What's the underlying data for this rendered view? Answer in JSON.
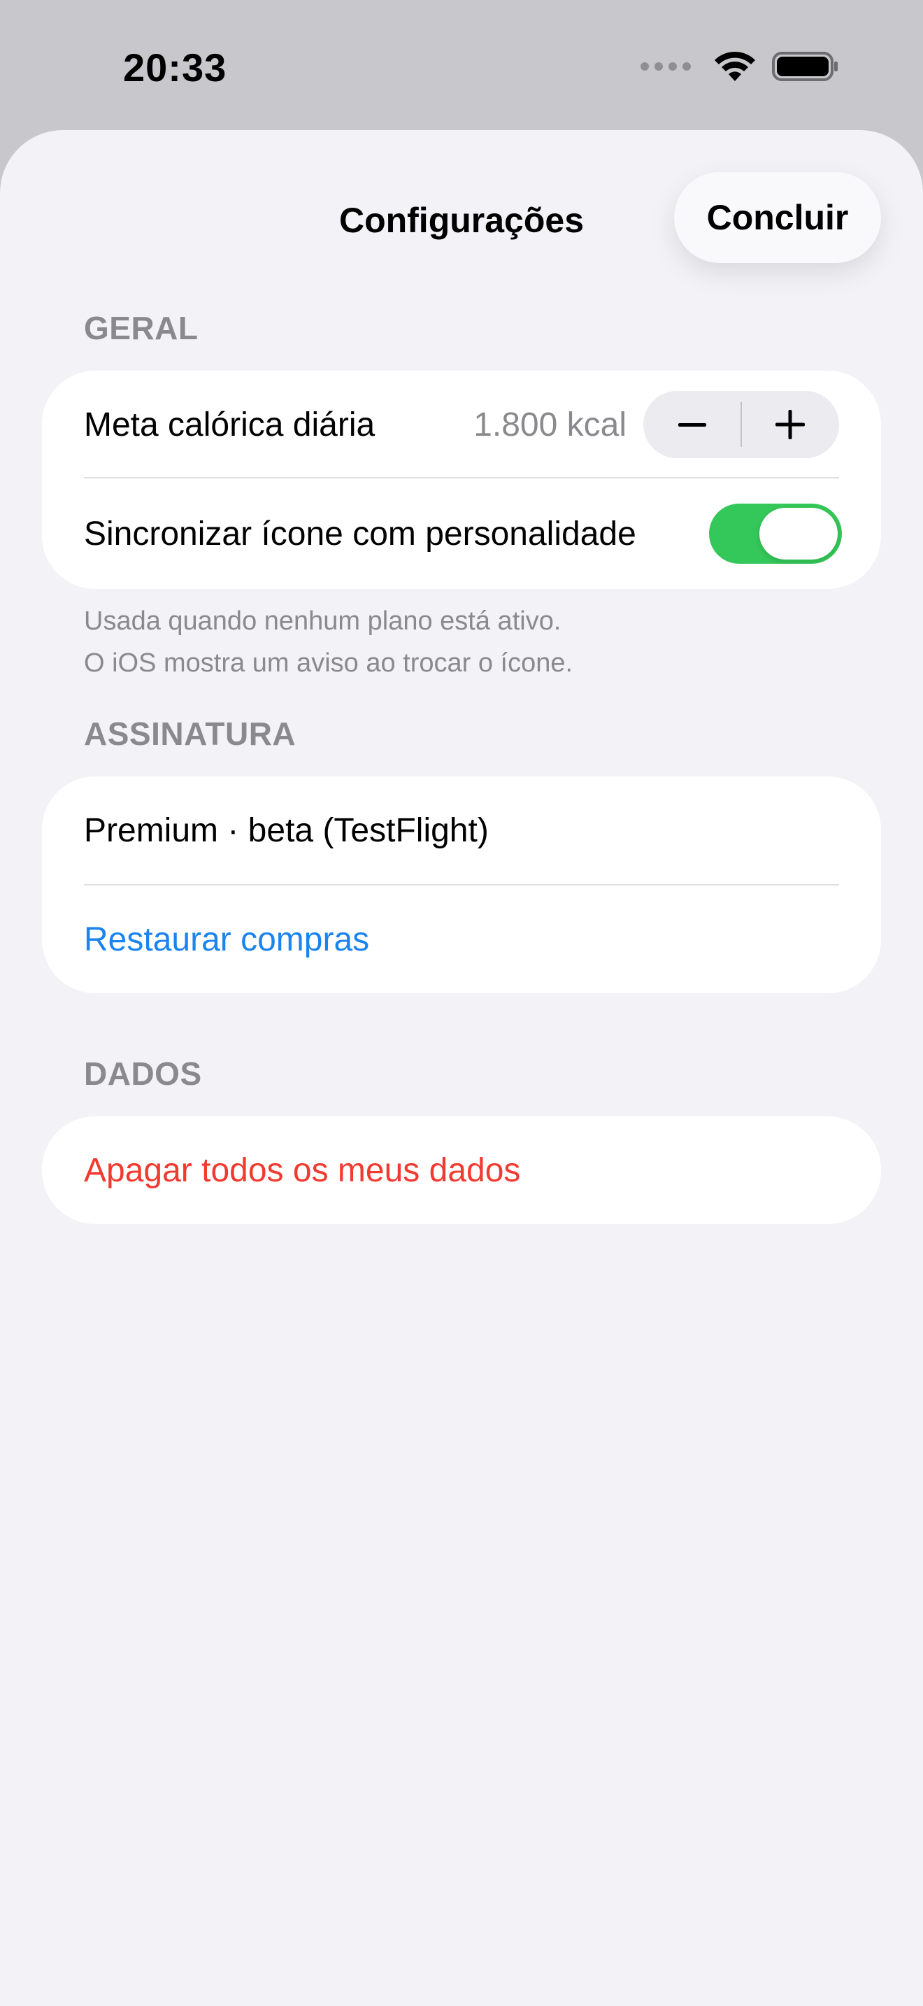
{
  "status_bar": {
    "time": "20:33"
  },
  "nav": {
    "title": "Configurações",
    "done_label": "Concluir"
  },
  "sections": {
    "general": {
      "header": "GERAL",
      "calorie_goal": {
        "label": "Meta calórica diária",
        "value": "1.800 kcal"
      },
      "sync_icon": {
        "label": "Sincronizar ícone com personalidade",
        "enabled": true
      },
      "footer_line1": "Usada quando nenhum plano está ativo.",
      "footer_line2": "O iOS mostra um aviso ao trocar o ícone."
    },
    "subscription": {
      "header": "ASSINATURA",
      "plan_label": "Premium · beta (TestFlight)",
      "restore_label": "Restaurar compras"
    },
    "data": {
      "header": "DADOS",
      "delete_label": "Apagar todos os meus dados"
    }
  },
  "colors": {
    "accent_blue": "#1a84ef",
    "destructive_red": "#f23a30",
    "toggle_on": "#34c759",
    "background": "#f2f2f7"
  },
  "icons": [
    "minus-icon",
    "plus-icon",
    "wifi-icon",
    "battery-icon",
    "cellular-signal-icon"
  ]
}
